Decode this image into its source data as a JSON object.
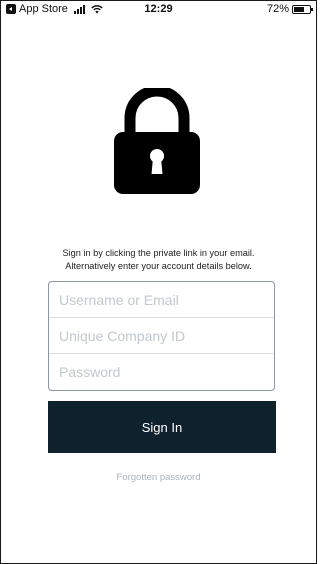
{
  "status_bar": {
    "back_app": "App Store",
    "time": "12:29",
    "battery": "72%",
    "battery_level": 0.72,
    "icons": [
      "back-arrow-icon",
      "signal-icon",
      "wifi-icon",
      "battery-icon"
    ]
  },
  "lock_icon": "lock-icon",
  "prompt": {
    "line1": "Sign in by clicking the private link in your email.",
    "line2": "Alternatively enter your account details below."
  },
  "form": {
    "username_placeholder": "Username or Email",
    "company_placeholder": "Unique Company ID",
    "password_placeholder": "Password",
    "signin_label": "Sign In",
    "forgot_label": "Forgotten password"
  },
  "colors": {
    "button_bg": "#10212e",
    "link": "#a9b3bd",
    "border": "#8d96a1"
  }
}
